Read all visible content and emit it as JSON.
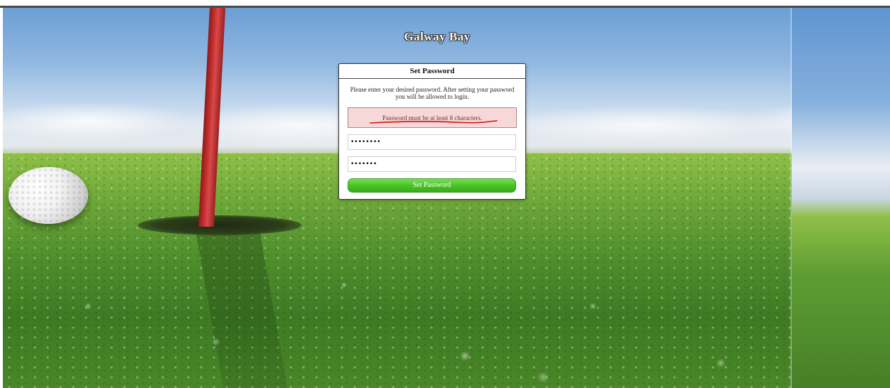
{
  "brand": {
    "title": "Galway Bay"
  },
  "dialog": {
    "title": "Set Password",
    "instructions": "Please enter your desired password. After setting your password you will be allowed to login.",
    "error_message": "Password must be at least 8 characters.",
    "password_field": {
      "value": "••••••••"
    },
    "confirm_field": {
      "value": "•••••••"
    },
    "submit_label": "Set Password"
  },
  "colors": {
    "error_background": "#f6d8d8",
    "annotation_underline": "#d01010",
    "button_green": "#4cc62a",
    "flag_red": "#c83030"
  },
  "background_icons": [
    "golf-ball-icon",
    "flagpole-icon"
  ]
}
